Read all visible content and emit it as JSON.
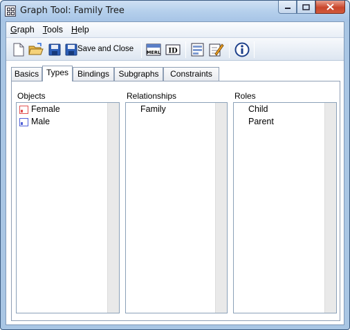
{
  "window": {
    "title": "Graph Tool: Family Tree"
  },
  "menu": [
    {
      "mnemonic": "G",
      "rest": "raph"
    },
    {
      "mnemonic": "T",
      "rest": "ools"
    },
    {
      "mnemonic": "H",
      "rest": "elp"
    }
  ],
  "toolbar": {
    "save_close_label": "Save and Close",
    "merl_label": "MERL",
    "id_label": "ID"
  },
  "tabs": [
    "Basics",
    "Types",
    "Bindings",
    "Subgraphs",
    "Constraints"
  ],
  "active_tab": "Types",
  "columns": {
    "objects": {
      "label": "Objects",
      "items": [
        "Female",
        "Male"
      ]
    },
    "relationships": {
      "label": "Relationships",
      "items": [
        "Family"
      ]
    },
    "roles": {
      "label": "Roles",
      "items": [
        "Child",
        "Parent"
      ]
    }
  },
  "colors": {
    "female_icon": "#e05050",
    "male_icon": "#5060d8"
  }
}
